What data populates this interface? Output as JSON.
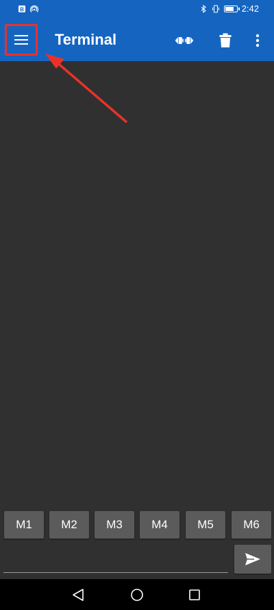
{
  "status_bar": {
    "time": "2:42",
    "battery_level": 0.85
  },
  "app_bar": {
    "title": "Terminal",
    "icons": {
      "menu": "menu-icon",
      "connect": "connect-icon",
      "delete": "trash-icon",
      "overflow": "more-vert-icon"
    },
    "highlight_color": "#e8322a"
  },
  "macros": [
    "M1",
    "M2",
    "M3",
    "M4",
    "M5",
    "M6"
  ],
  "input": {
    "value": "",
    "placeholder": ""
  },
  "colors": {
    "primary": "#1565c0",
    "background": "#303030",
    "button": "#5b5b5b",
    "annotation": "#e8322a"
  }
}
